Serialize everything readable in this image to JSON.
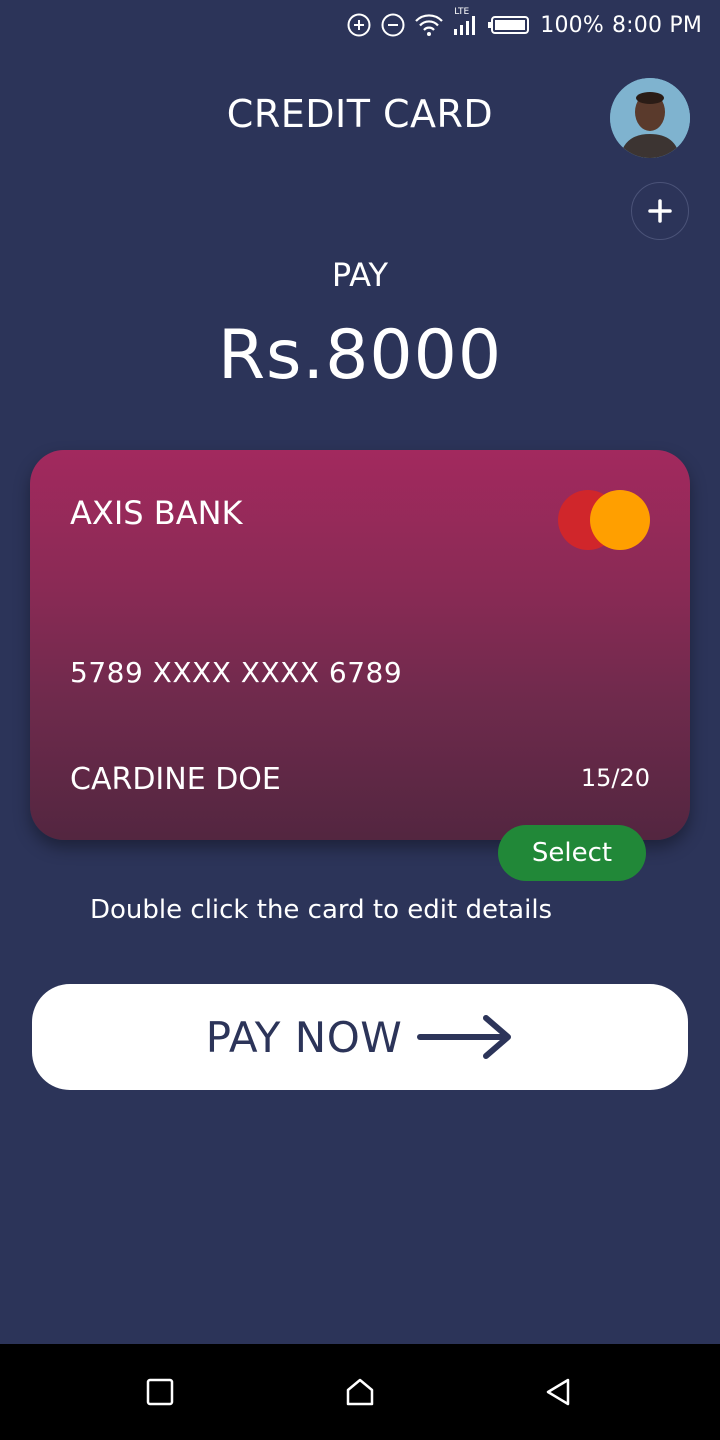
{
  "status_bar": {
    "battery_percent": "100%",
    "time": "8:00 PM",
    "network_label": "LTE",
    "icons": [
      "add-circle-icon",
      "minus-circle-icon",
      "wifi-icon",
      "signal-icon",
      "battery-icon"
    ]
  },
  "header": {
    "title": "CREDIT CARD",
    "avatar_icon": "user-avatar",
    "add_icon": "plus-icon"
  },
  "payment": {
    "label": "PAY",
    "amount": "Rs.8000"
  },
  "card": {
    "bank_name": "AXIS BANK",
    "number": "5789 XXXX XXXX 6789",
    "holder_name": "CARDINE DOE",
    "expiry": "15/20",
    "brand_icon": "mastercard-logo",
    "colors": {
      "gradient_top": "#a2295e",
      "gradient_bottom": "#532640",
      "mc_red": "#d0262b",
      "mc_orange": "#ff9f00"
    }
  },
  "select_button": {
    "label": "Select",
    "color": "#218838"
  },
  "hint": {
    "text": "Double click the card to edit details"
  },
  "pay_now": {
    "label": "PAY NOW",
    "icon": "arrow-right-icon"
  },
  "nav_bar": {
    "icons": [
      "recent-apps-icon",
      "home-icon",
      "back-icon"
    ]
  },
  "colors": {
    "background": "#2c3459",
    "text": "#ffffff"
  }
}
